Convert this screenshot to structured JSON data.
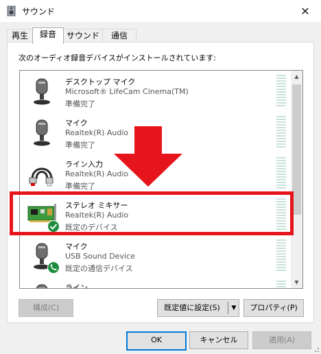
{
  "window": {
    "title": "サウンド",
    "close_glyph": "✕"
  },
  "tabs": [
    {
      "label": "再生"
    },
    {
      "label": "録音",
      "active": true
    },
    {
      "label": "サウンド"
    },
    {
      "label": "通信"
    }
  ],
  "instruction": "次のオーディオ録音デバイスがインストールされています:",
  "devices": [
    {
      "name": "デスクトップ マイク",
      "driver": "Microsoft® LifeCam Cinema(TM)",
      "status": "準備完了",
      "icon": "microphone-icon"
    },
    {
      "name": "マイク",
      "driver": "Realtek(R) Audio",
      "status": "準備完了",
      "icon": "microphone-icon"
    },
    {
      "name": "ライン入力",
      "driver": "Realtek(R) Audio",
      "status": "準備完了",
      "icon": "rca-cable-icon"
    },
    {
      "name": "ステレオ ミキサー",
      "driver": "Realtek(R) Audio",
      "status": "既定のデバイス",
      "icon": "sound-card-icon",
      "badge": "default-check-icon"
    },
    {
      "name": "マイク",
      "driver": "USB Sound Device",
      "status": "既定の通信デバイス",
      "icon": "microphone-icon",
      "badge": "phone-icon"
    },
    {
      "name": "ライン",
      "driver": "",
      "status": "",
      "icon": "microphone-icon"
    }
  ],
  "buttons": {
    "configure": "構成(C)",
    "set_default": "既定値に設定(S)",
    "properties": "プロパティ(P)",
    "ok": "OK",
    "cancel": "キャンセル",
    "apply": "適用(A)"
  },
  "colors": {
    "highlight_annotation": "#e6151b",
    "meter": "#c9e2d8",
    "default_check": "#1e8e3e",
    "accent": "#0078d7"
  }
}
